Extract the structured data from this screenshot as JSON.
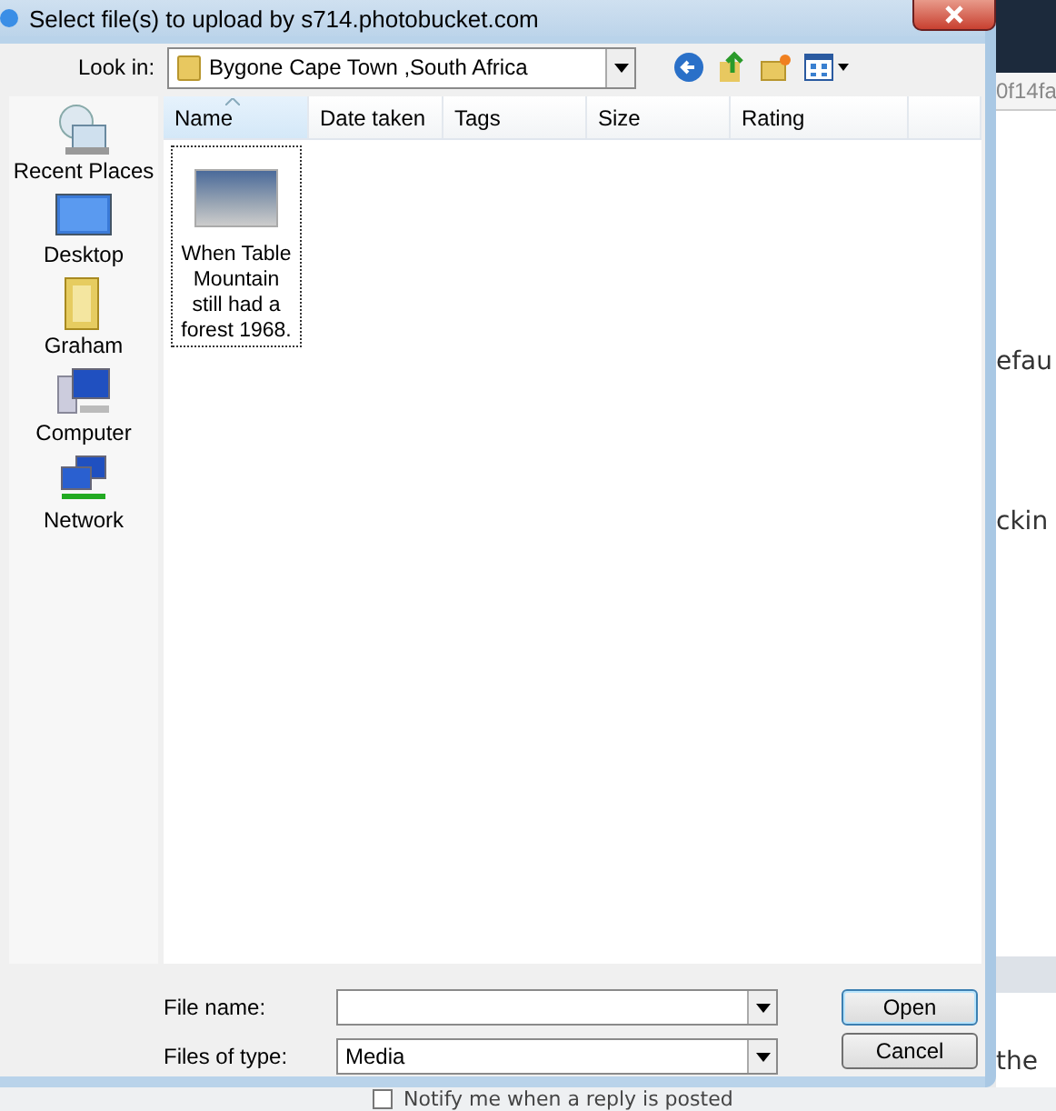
{
  "window": {
    "title": "Select file(s) to upload by s714.photobucket.com"
  },
  "look_in": {
    "label": "Look in:",
    "value": "Bygone Cape Town ,South Africa"
  },
  "places": [
    {
      "label": "Recent Places",
      "kind": "recent"
    },
    {
      "label": "Desktop",
      "kind": "desktop"
    },
    {
      "label": "Graham",
      "kind": "user"
    },
    {
      "label": "Computer",
      "kind": "computer"
    },
    {
      "label": "Network",
      "kind": "network"
    }
  ],
  "columns": [
    {
      "label": "Name",
      "sorted": true
    },
    {
      "label": "Date taken",
      "sorted": false
    },
    {
      "label": "Tags",
      "sorted": false
    },
    {
      "label": "Size",
      "sorted": false
    },
    {
      "label": "Rating",
      "sorted": false
    }
  ],
  "files": [
    {
      "name": "When Table Mountain still had a forest 1968.",
      "focused": true
    }
  ],
  "file_name": {
    "label": "File name:"
  },
  "file_type": {
    "label": "Files of type:",
    "value": "Media"
  },
  "buttons": [
    {
      "label": "Open",
      "kind": "default"
    },
    {
      "label": "Cancel",
      "kind": "normal"
    }
  ],
  "background_page": {
    "address_fragment": "0f14fa",
    "text_fragments": [
      "efau",
      "ckin"
    ],
    "side_text": "the",
    "notify": {
      "label": "Notify me when a reply is posted",
      "checked": false
    }
  }
}
